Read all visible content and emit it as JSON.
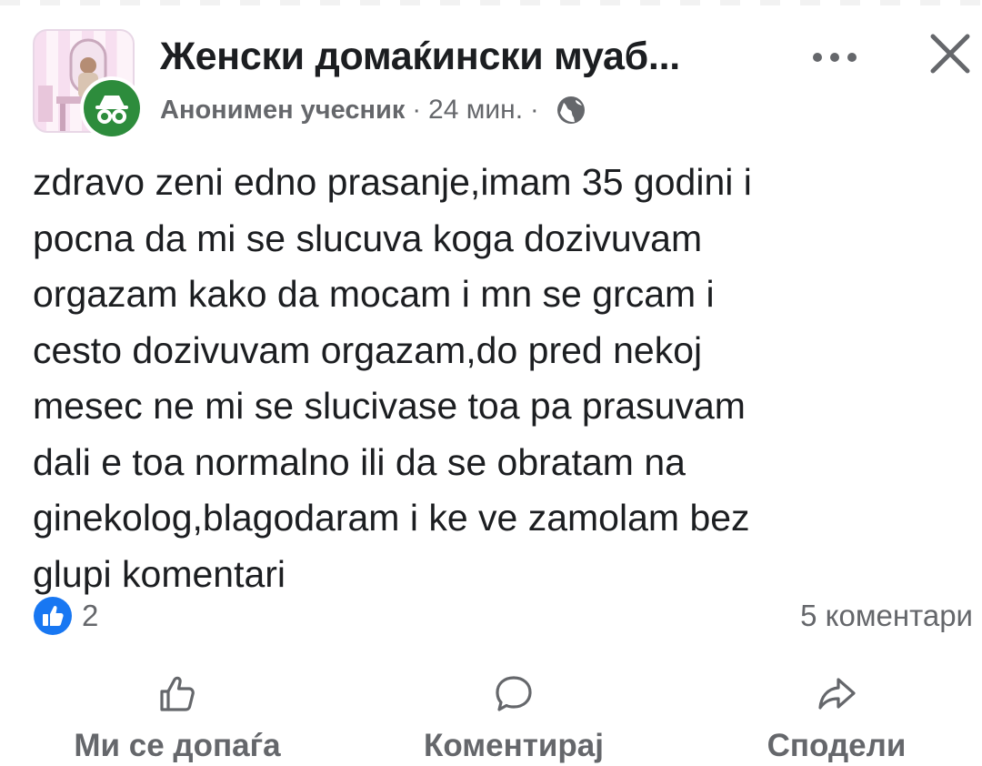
{
  "header": {
    "group_name": "Женски домаќински муаб...",
    "author": "Анонимен учесник",
    "separator": "·",
    "time": "24 мин."
  },
  "post": {
    "text": "zdravo zeni edno prasanje,imam 35 godini i\npocna da mi se slucuva koga dozivuvam\norgazam kako da mocam i mn se grcam i\ncesto dozivuvam orgazam,do pred nekoj\nmesec ne mi se slucivase toa pa prasuvam\ndali e toa normalno ili da se obratam na\nginekolog,blagodaram i ke ve zamolam bez\nglupi komentari"
  },
  "stats": {
    "reactions_count": "2",
    "comments_count": "5 коментари"
  },
  "actions": {
    "like_label": "Ми се допаѓа",
    "comment_label": "Коментирај",
    "share_label": "Сподели"
  },
  "icons": {
    "anonymous": "incognito-icon",
    "privacy": "globe-icon",
    "more": "more-icon",
    "close": "close-icon",
    "reaction": "like-reaction-icon",
    "like": "thumbs-up-icon",
    "comment": "comment-icon",
    "share": "share-icon"
  },
  "colors": {
    "anon_badge": "#2d8c3c",
    "like_blue": "#1877f2",
    "secondary_text": "#65676b",
    "primary_text": "#1c1e21"
  }
}
